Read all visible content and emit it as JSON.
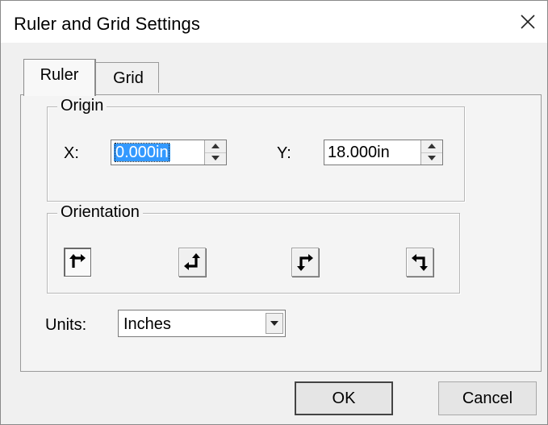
{
  "window": {
    "title": "Ruler and Grid Settings"
  },
  "icons": {
    "close": "close-icon"
  },
  "tabs": [
    {
      "label": "Ruler",
      "active": true
    },
    {
      "label": "Grid",
      "active": false
    }
  ],
  "origin": {
    "group_label": "Origin",
    "x_label": "X:",
    "x_value": "0.000in",
    "y_label": "Y:",
    "y_value": "18.000in"
  },
  "orientation": {
    "group_label": "Orientation",
    "options": [
      {
        "name": "up-right",
        "selected": true
      },
      {
        "name": "up-left",
        "selected": false
      },
      {
        "name": "down-right",
        "selected": false
      },
      {
        "name": "down-left",
        "selected": false
      }
    ]
  },
  "units": {
    "label": "Units:",
    "selected": "Inches"
  },
  "buttons": {
    "ok": "OK",
    "cancel": "Cancel"
  },
  "colors": {
    "selection": "#3399ff",
    "dialog_bg": "#f0f0f0"
  }
}
